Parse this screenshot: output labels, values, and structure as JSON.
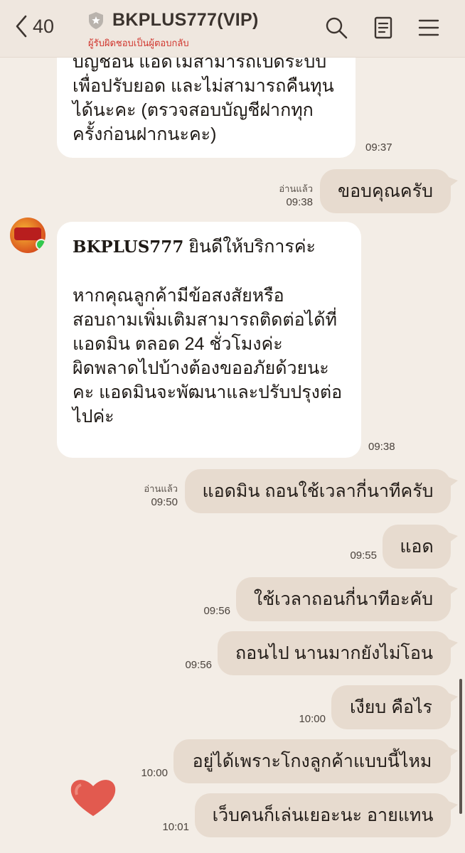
{
  "header": {
    "back_count": "40",
    "title": "BKPLUS777(VIP)",
    "subtitle": "ผู้รับผิดชอบเป็นผู้ตอบกลับ"
  },
  "messages": [
    {
      "side": "recv",
      "lines": [
        "บัญชีอื่น แอดไม่สามารถเปิดระบบ",
        "เพื่อปรับยอด และไม่สามารถคืนทุน",
        "ได้นะคะ (ตรวจสอบบัญชีฝากทุก",
        "ครั้งก่อนฝากนะคะ)"
      ],
      "time": "09:37"
    },
    {
      "side": "sent",
      "text": "ขอบคุณครับ",
      "read": "อ่านแล้ว",
      "time": "09:38"
    },
    {
      "side": "recv",
      "bold": "BKPLUS777",
      "first_rest": " ยินดีให้บริการค่ะ",
      "lines": [
        "หากคุณลูกค้ามีข้อสงสัยหรือ",
        "สอบถามเพิ่มเติมสามารถติดต่อได้ที่",
        "แอดมิน ตลอด 24 ชั่วโมงค่ะ",
        "ผิดพลาดไปบ้างต้องขออภัยด้วยนะ",
        "คะ แอดมินจะพัฒนาและปรับปรุงต่อ",
        "ไปค่ะ"
      ],
      "time": "09:38"
    },
    {
      "side": "sent",
      "text": "แอดมิน ถอนใช้เวลากี่นาทีครับ",
      "read": "อ่านแล้ว",
      "time": "09:50"
    },
    {
      "side": "sent",
      "text": "แอด",
      "time": "09:55"
    },
    {
      "side": "sent",
      "text": "ใช้เวลาถอนกี่นาทีอะคับ",
      "time": "09:56"
    },
    {
      "side": "sent",
      "text": "ถอนไป นานมากยังไม่โอน",
      "time": "09:56"
    },
    {
      "side": "sent",
      "text": "เงียบ คือไร",
      "time": "10:00"
    },
    {
      "side": "sent",
      "text": "อยู่ได้เพราะโกงลูกค้าแบบนี้ไหม",
      "time": "10:00"
    },
    {
      "side": "sent",
      "text": "เว็บคนก็เล่นเยอะนะ อายแทน",
      "time": "10:01"
    }
  ],
  "colors": {
    "header_bg": "#efe7df",
    "chat_bg": "#f3ede6",
    "sent_bubble": "#e7dbcf",
    "recv_bubble": "#ffffff",
    "subtitle": "#d0342c"
  }
}
